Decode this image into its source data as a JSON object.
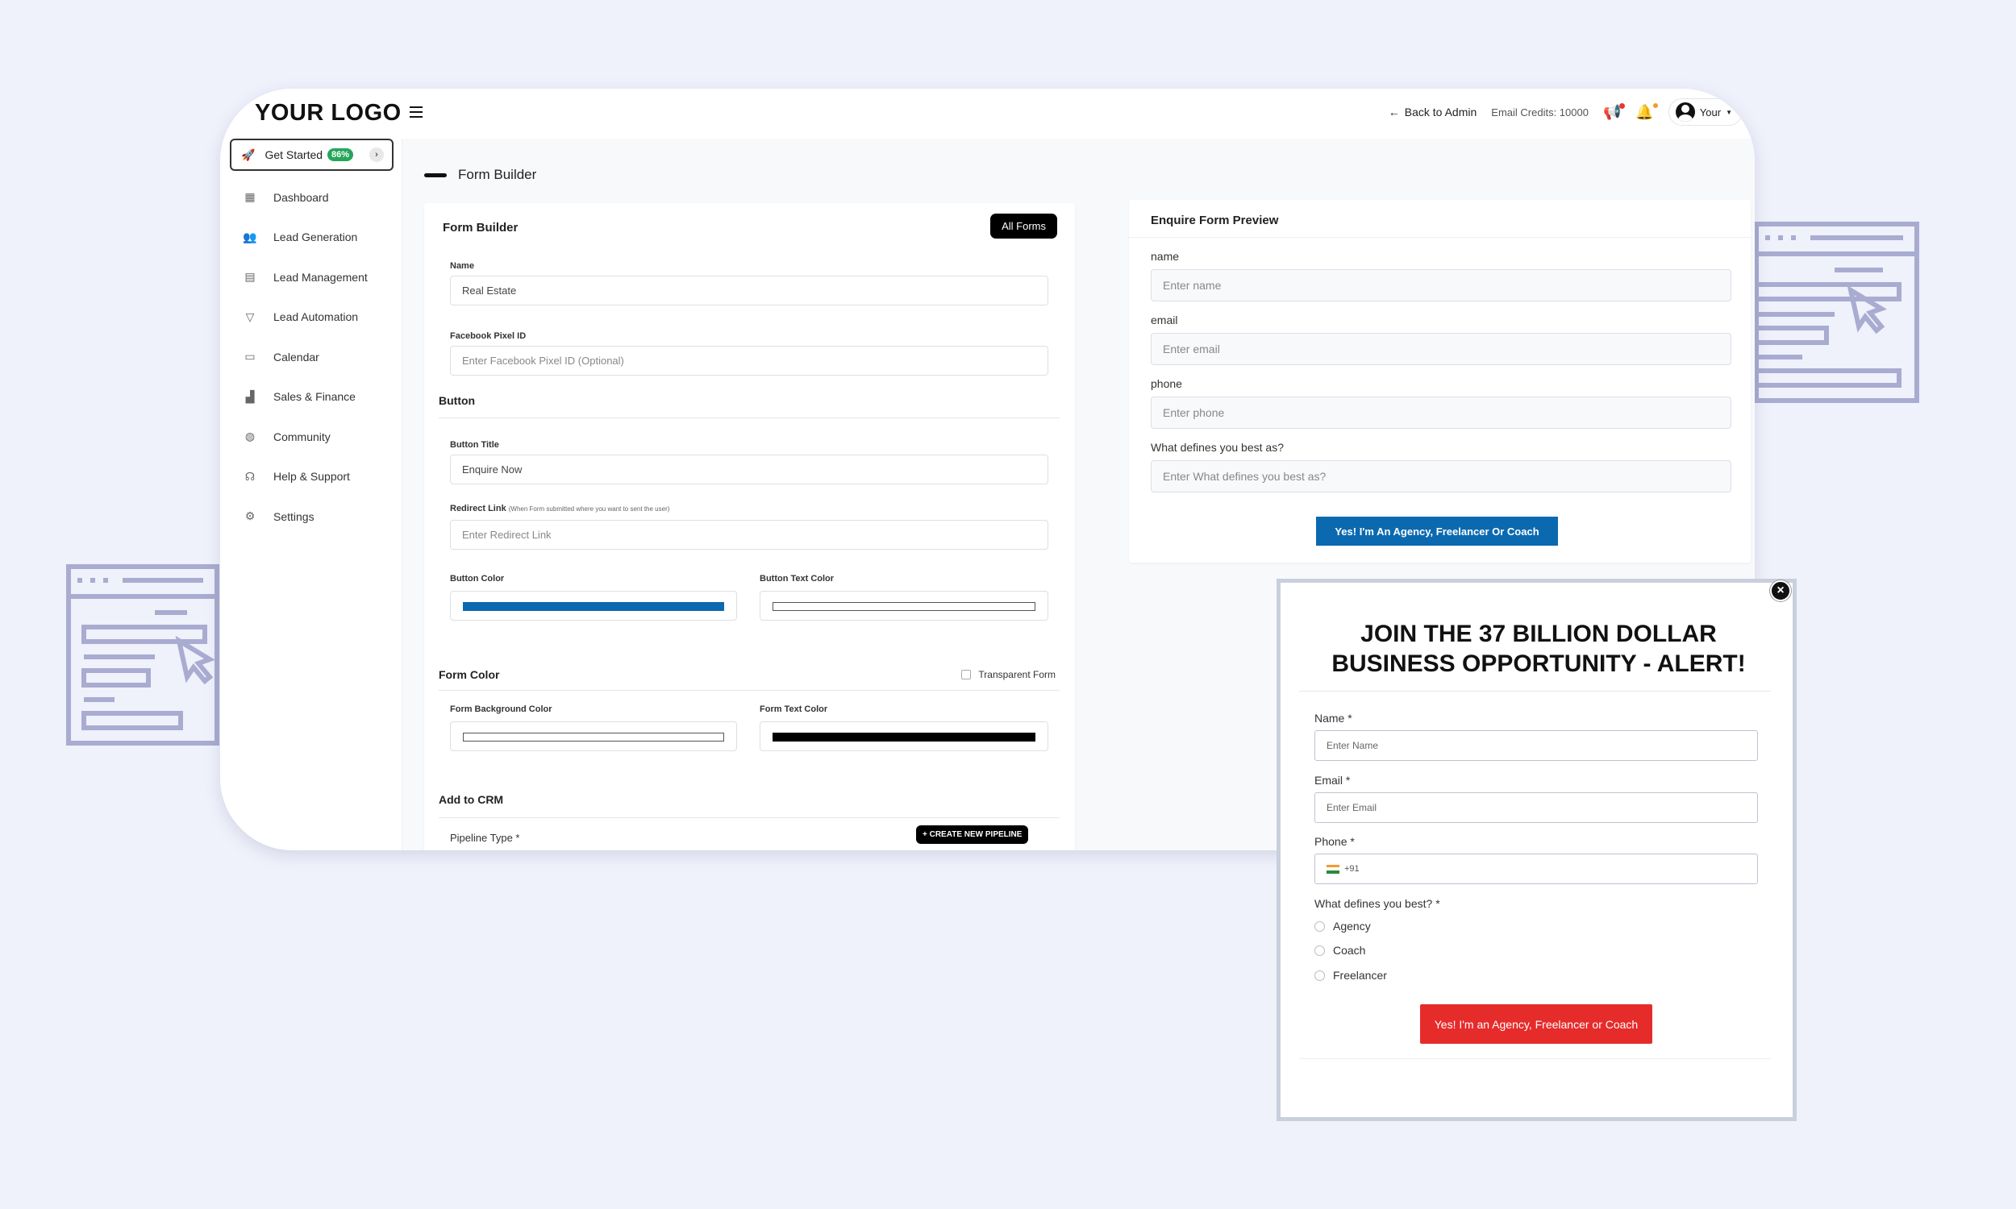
{
  "app": {
    "logo": "YOUR LOGO",
    "back_to_admin": "Back to Admin",
    "email_credits": "Email Credits: 10000",
    "user_label": "Your"
  },
  "sidebar": {
    "get_started": {
      "label": "Get Started",
      "badge": "86%"
    },
    "items": [
      {
        "label": "Dashboard",
        "icon": "dashboard-icon"
      },
      {
        "label": "Lead Generation",
        "icon": "users-icon"
      },
      {
        "label": "Lead Management",
        "icon": "address-book-icon"
      },
      {
        "label": "Lead Automation",
        "icon": "funnel-icon"
      },
      {
        "label": "Calendar",
        "icon": "calendar-icon"
      },
      {
        "label": "Sales & Finance",
        "icon": "chart-icon"
      },
      {
        "label": "Community",
        "icon": "community-icon"
      },
      {
        "label": "Help & Support",
        "icon": "headset-icon"
      },
      {
        "label": "Settings",
        "icon": "gear-icon"
      }
    ]
  },
  "page": {
    "title": "Form Builder"
  },
  "builder": {
    "title": "Form Builder",
    "all_forms": "All Forms",
    "name_label": "Name",
    "name_value": "Real Estate",
    "pixel_label": "Facebook Pixel ID",
    "pixel_placeholder": "Enter Facebook Pixel ID (Optional)",
    "button_section": "Button",
    "button_title_label": "Button Title",
    "button_title_value": "Enquire Now",
    "redirect_label": "Redirect Link",
    "redirect_hint": "(When Form submitted where you want to sent the user)",
    "redirect_placeholder": "Enter Redirect Link",
    "button_color_label": "Button Color",
    "button_color": "#0b69b0",
    "button_text_color_label": "Button Text Color",
    "button_text_color": "#ffffff",
    "form_color_section": "Form Color",
    "transparent_label": "Transparent Form",
    "form_bg_label": "Form Background Color",
    "form_bg_color": "#ffffff",
    "form_text_label": "Form Text Color",
    "form_text_color": "#000000",
    "crm_section": "Add to CRM",
    "pipeline_label": "Pipeline Type *",
    "create_pipeline": "+ CREATE NEW PIPELINE"
  },
  "preview": {
    "title": "Enquire Form Preview",
    "fields": [
      {
        "label": "name",
        "placeholder": "Enter name"
      },
      {
        "label": "email",
        "placeholder": "Enter email"
      },
      {
        "label": "phone",
        "placeholder": "Enter phone"
      },
      {
        "label": "What defines you best as?",
        "placeholder": "Enter What defines you best as?"
      }
    ],
    "button": "Yes! I'm An Agency, Freelancer Or Coach"
  },
  "popup": {
    "title": "JOIN THE 37 BILLION DOLLAR BUSINESS OPPORTUNITY - ALERT!",
    "name_label": "Name *",
    "name_placeholder": "Enter Name",
    "email_label": "Email *",
    "email_placeholder": "Enter Email",
    "phone_label": "Phone *",
    "phone_code": "+91",
    "question": "What defines you best? *",
    "options": [
      "Agency",
      "Coach",
      "Freelancer"
    ],
    "submit": "Yes! I'm an Agency, Freelancer or Coach"
  },
  "colors": {
    "accent_blue": "#0b69b0",
    "submit_red": "#e62b2b",
    "badge_green": "#26a65b"
  }
}
